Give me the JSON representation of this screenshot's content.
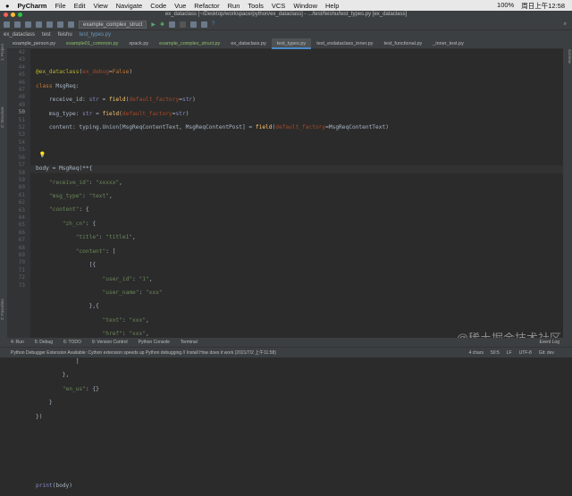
{
  "menubar": {
    "app": "PyCharm",
    "items": [
      "File",
      "Edit",
      "View",
      "Navigate",
      "Code",
      "Vue",
      "Refactor",
      "Run",
      "Tools",
      "VCS",
      "Window",
      "Help"
    ],
    "battery": "100%",
    "clock": "周日上午12:58"
  },
  "window_title": "ex_dataclass [~/Desktop/workspace/python/ex_dataclass] - .../test/feishu/test_types.py [ex_dataclass]",
  "toolbar": {
    "run_config": "example_complex_struct"
  },
  "breadcrumbs": [
    "ex_dataclass",
    "test",
    "feishu",
    "test_types.py"
  ],
  "tabs": [
    {
      "label": "example_person.py"
    },
    {
      "label": "example01_common.py"
    },
    {
      "label": "xpack.py"
    },
    {
      "label": "example_complex_struct.py"
    },
    {
      "label": "ex_dataclass.py"
    },
    {
      "label": "test_types.py",
      "active": true
    },
    {
      "label": "test_exdataclass_inner.py"
    },
    {
      "label": "test_functional.py"
    },
    {
      "label": "_inner_test.py"
    }
  ],
  "side": {
    "left_top": "1: Project",
    "left_mid": "Z: Structure",
    "left_bottom": "2: Favorites",
    "right": "SciView"
  },
  "editor": {
    "line_start": 42,
    "current_line": 50
  },
  "toolwindows": [
    "4: Run",
    "5: Debug",
    "6: TODO",
    "9: Version Control",
    "Python Console",
    "Terminal"
  ],
  "event_log": "Event Log",
  "status": {
    "message": "Python Debugger Extension Available: Cython extension speeds up Python debugging // Install How does it work (2021/7/2 上午11:58)",
    "chars": "4 chars",
    "pos": "50:5",
    "lf": "LF",
    "enc": "UTF-8",
    "git": "Git: dev"
  },
  "watermark": "@稀土掘金技术社区"
}
